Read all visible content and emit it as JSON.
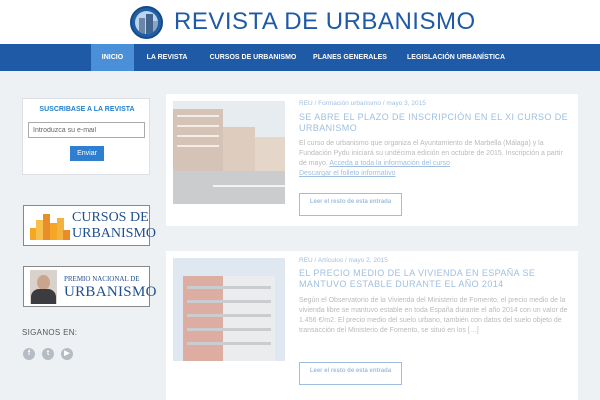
{
  "header": {
    "site_title": "REVISTA DE URBANISMO"
  },
  "nav": {
    "items": [
      {
        "label": "INICIO",
        "active": true
      },
      {
        "label": "LA REVISTA",
        "active": false
      },
      {
        "label": "CURSOS DE URBANISMO",
        "active": false
      },
      {
        "label": "PLANES GENERALES",
        "active": false
      },
      {
        "label": "LEGISLACIÓN URBANÍSTICA",
        "active": false
      }
    ]
  },
  "sidebar": {
    "subscribe_title": "SUSCRIBASE A LA REVISTA",
    "email_placeholder": "Introduzca su e-mail",
    "send_label": "Enviar",
    "banner_cursos": {
      "line1": "CURSOS DE",
      "line2": "URBANISMO"
    },
    "banner_premio": {
      "line1": "PREMIO NACIONAL DE",
      "line2": "URBANISMO"
    },
    "follow_label": "SIGANOS EN:",
    "social": [
      {
        "icon": "facebook-icon",
        "glyph": "f"
      },
      {
        "icon": "twitter-icon",
        "glyph": "t"
      },
      {
        "icon": "youtube-icon",
        "glyph": "▶"
      }
    ]
  },
  "posts": [
    {
      "meta": "REU / Formación urbanismo / mayo 3, 2015",
      "title": "SE ABRE EL PLAZO DE INSCRIPCIÓN EN EL XI CURSO DE URBANISMO",
      "excerpt": "El curso de urbanismo que organiza el Ayuntamiento de Marbella (Málaga) y la Fundación Pydu iniciará su undécima edición en octubre de 2015. Inscripción a partir de mayo.",
      "link1": "Acceda a toda la información del curso",
      "link2": "Descargar el folleto informativo",
      "read_more": "Leer el resto de esta entrada"
    },
    {
      "meta": "REU / Artículos / mayo 2, 2015",
      "title": "EL PRECIO MEDIO DE LA VIVIENDA EN ESPAÑA SE MANTUVO ESTABLE DURANTE EL AÑO 2014",
      "excerpt": "Según el Observatorio de la Vivienda del Ministerio de Fomento, el precio medio de la vivienda libre se mantuvo estable en toda España durante el año 2014 con un valor de 1.456 €/m2. El precio medio del suelo urbano, también con datos del suelo objeto de transacción del Ministerio de Fomento, se situó en los […]",
      "read_more": "Leer el resto de esta entrada"
    }
  ],
  "colors": {
    "brand_blue": "#1f5aa6",
    "nav_active": "#4a90d9",
    "link_blue": "#2a6fb9"
  }
}
